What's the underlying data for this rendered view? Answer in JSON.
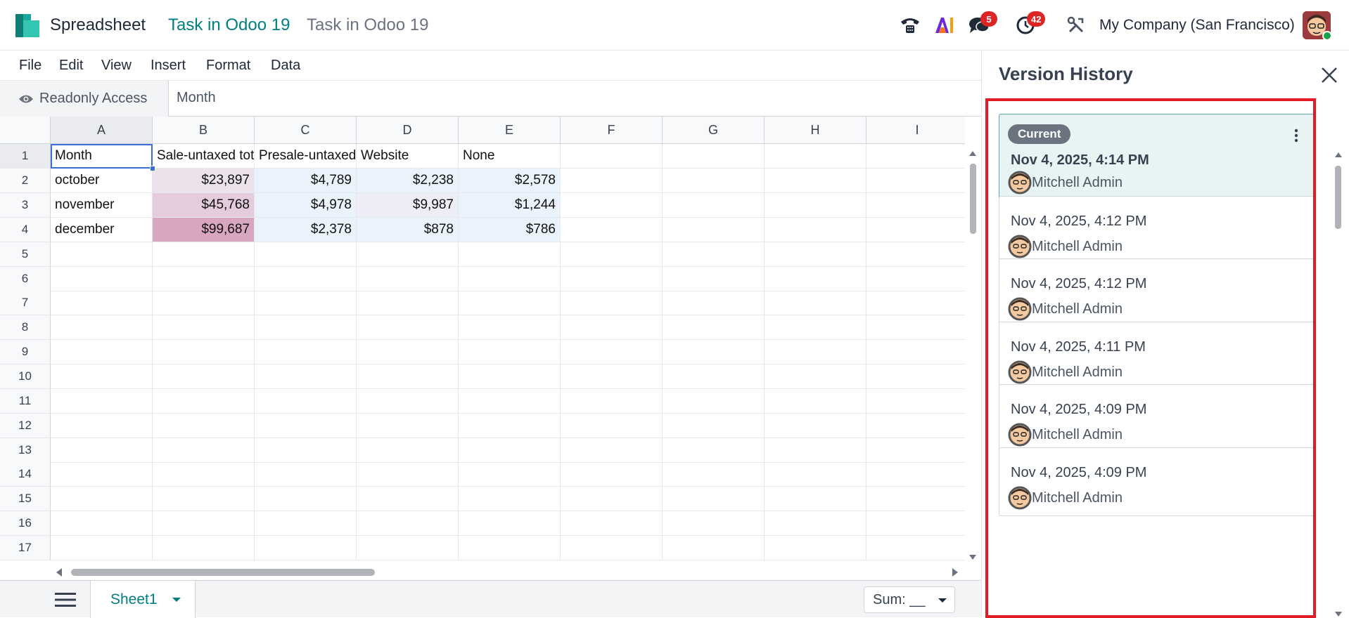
{
  "navbar": {
    "app_name": "Spreadsheet",
    "breadcrumb_active": "Task in Odoo 19",
    "breadcrumb_inactive": "Task in Odoo 19",
    "messages_count": "5",
    "activities_count": "42",
    "company": "My Company (San Francisco)",
    "icons": [
      "phone-icon",
      "ai-icon",
      "chat-icon",
      "clock-icon",
      "tools-icon"
    ]
  },
  "menu": {
    "items": [
      "File",
      "Edit",
      "View",
      "Insert",
      "Format",
      "Data"
    ]
  },
  "formula_bar": {
    "access_label": "Readonly Access",
    "value": "Month"
  },
  "grid": {
    "columns": [
      "A",
      "B",
      "C",
      "D",
      "E",
      "F",
      "G",
      "H",
      "I"
    ],
    "rows": [
      "1",
      "2",
      "3",
      "4",
      "5",
      "6",
      "7",
      "8",
      "9",
      "10",
      "11",
      "12",
      "13",
      "14",
      "15",
      "16",
      "17"
    ],
    "header_row": [
      "Month",
      "Sale-untaxed total",
      "Presale-untaxed total",
      "Website",
      "None"
    ],
    "data": [
      [
        "october",
        "$23,897",
        "$4,789",
        "$2,238",
        "$2,578"
      ],
      [
        "november",
        "$45,768",
        "$4,978",
        "$9,987",
        "$1,244"
      ],
      [
        "december",
        "$99,687",
        "$2,378",
        "$878",
        "$786"
      ]
    ],
    "heat_colors": {
      "b2": "#ece2ec",
      "b3": "#e4ccdd",
      "b4": "#d9a6c0",
      "c": "#eaf2fb",
      "d2": "#eaf2fb",
      "d3": "#eeecf6",
      "d4": "#eaf2fb",
      "e": "#eaf2fb"
    }
  },
  "bottom": {
    "sheet_name": "Sheet1",
    "sum_label": "Sum: __"
  },
  "version_history": {
    "title": "Version History",
    "current_label": "Current",
    "versions": [
      {
        "date": "Nov 4, 2025, 4:14 PM",
        "user": "Mitchell Admin",
        "current": true
      },
      {
        "date": "Nov 4, 2025, 4:12 PM",
        "user": "Mitchell Admin"
      },
      {
        "date": "Nov 4, 2025, 4:12 PM",
        "user": "Mitchell Admin"
      },
      {
        "date": "Nov 4, 2025, 4:11 PM",
        "user": "Mitchell Admin"
      },
      {
        "date": "Nov 4, 2025, 4:09 PM",
        "user": "Mitchell Admin"
      },
      {
        "date": "Nov 4, 2025, 4:09 PM",
        "user": "Mitchell Admin"
      }
    ],
    "highlight_color": "#e01b24"
  },
  "colors": {
    "brand_teal": "#017e84",
    "selection_blue": "#3b6fd6"
  }
}
